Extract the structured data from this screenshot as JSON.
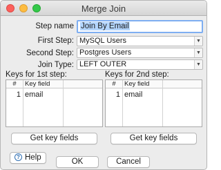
{
  "window": {
    "title": "Merge Join"
  },
  "form": {
    "step_name_label": "Step name",
    "step_name_value": "Join By Email",
    "first_step_label": "First Step:",
    "first_step_value": "MySQL Users",
    "second_step_label": "Second Step:",
    "second_step_value": "Postgres Users",
    "join_type_label": "Join Type:",
    "join_type_value": "LEFT OUTER"
  },
  "keys_first": {
    "label": "Keys for 1st step:",
    "col_num": "#",
    "col_key": "Key field",
    "rows": [
      {
        "num": "1",
        "key": "email"
      }
    ],
    "button": "Get key fields"
  },
  "keys_second": {
    "label": "Keys for 2nd step:",
    "col_num": "#",
    "col_key": "Key field",
    "rows": [
      {
        "num": "1",
        "key": "email"
      }
    ],
    "button": "Get key fields"
  },
  "footer": {
    "help_label": "Help",
    "ok_label": "OK",
    "cancel_label": "Cancel"
  },
  "colors": {
    "close": "#fc605c",
    "minimize": "#fdbc40",
    "maximize": "#34c84a",
    "focus_ring": "#7eaef1",
    "selection": "#b3d5fd",
    "help_accent": "#2f6fb3"
  },
  "icons": [
    "close-dot-icon",
    "minimize-dot-icon",
    "maximize-dot-icon",
    "dropdown-arrow-icon",
    "help-icon"
  ]
}
